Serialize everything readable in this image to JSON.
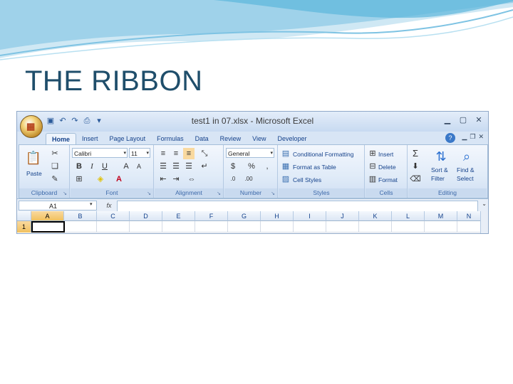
{
  "slide": {
    "title": "THE RIBBON"
  },
  "window": {
    "title": "test1 in 07.xlsx - Microsoft Excel",
    "office_logo": "office-logo",
    "qat_icons": [
      "save-icon",
      "undo-icon",
      "redo-icon",
      "print-icon",
      "customize-icon"
    ],
    "controls": [
      "minimize-icon",
      "maximize-icon",
      "close-icon"
    ]
  },
  "tabs": [
    "Home",
    "Insert",
    "Page Layout",
    "Formulas",
    "Data",
    "Review",
    "View",
    "Developer"
  ],
  "active_tab": "Home",
  "ribbon": {
    "clipboard": {
      "label": "Clipboard",
      "paste": "Paste"
    },
    "font": {
      "label": "Font",
      "family": "Calibri",
      "size": "11",
      "bold": "B",
      "italic": "I",
      "underline": "U"
    },
    "alignment": {
      "label": "Alignment"
    },
    "number": {
      "label": "Number",
      "format": "General",
      "percent": "%"
    },
    "styles": {
      "label": "Styles",
      "conditional": "Conditional Formatting",
      "format_table": "Format as Table",
      "cell_styles": "Cell Styles"
    },
    "cells": {
      "label": "Cells",
      "insert": "Insert",
      "delete": "Delete",
      "format": "Format"
    },
    "editing": {
      "label": "Editing",
      "sort_line1": "Sort &",
      "sort_line2": "Filter",
      "find_line1": "Find &",
      "find_line2": "Select",
      "sum": "Σ"
    }
  },
  "formula_bar": {
    "name_box": "A1",
    "fx": "fx"
  },
  "grid": {
    "columns": [
      "A",
      "B",
      "C",
      "D",
      "E",
      "F",
      "G",
      "H",
      "I",
      "J",
      "K",
      "L",
      "M",
      "N"
    ],
    "rows": [
      "1"
    ]
  },
  "colors": {
    "title": "#1f4e6b",
    "ribbon_text": "#15428b",
    "selected_header": "#f1c15f"
  }
}
